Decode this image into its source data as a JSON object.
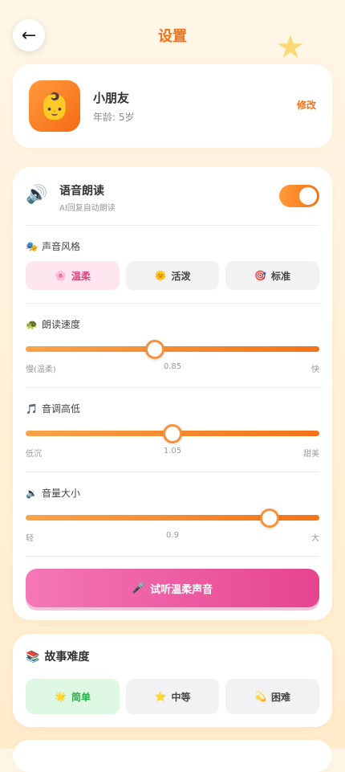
{
  "header": {
    "back_icon": "arrow-left-icon",
    "back_glyph": "←",
    "title": "设置",
    "decor_star": "★"
  },
  "profile": {
    "avatar_emoji": "👶",
    "name": "小朋友",
    "age_text": "年龄: 5岁",
    "edit_label": "修改"
  },
  "voice": {
    "speaker_glyph": "🔊",
    "title": "语音朗读",
    "subtitle": "AI回复自动朗读",
    "auto_read_enabled": true,
    "style": {
      "icon": "🎭",
      "label": "声音风格",
      "options": [
        {
          "icon": "🌸",
          "label": "温柔",
          "selected": true
        },
        {
          "icon": "🌞",
          "label": "活泼",
          "selected": false
        },
        {
          "icon": "🎯",
          "label": "标准",
          "selected": false
        }
      ]
    },
    "speed": {
      "icon": "🐢",
      "label": "朗读速度",
      "min_label": "慢(温柔)",
      "max_label": "快",
      "value_text": "0.85",
      "fraction": 0.44
    },
    "pitch": {
      "icon": "🎵",
      "label": "音调高低",
      "min_label": "低沉",
      "max_label": "甜美",
      "value_text": "1.05",
      "fraction": 0.5
    },
    "volume": {
      "icon": "🔉",
      "label": "音量大小",
      "min_label": "轻",
      "max_label": "大",
      "value_text": "0.9",
      "fraction": 0.83
    },
    "preview": {
      "icon": "🎤",
      "label": "试听温柔声音"
    }
  },
  "story": {
    "icon": "📚",
    "title": "故事难度",
    "options": [
      {
        "icon": "🌟",
        "label": "简单",
        "selected": true
      },
      {
        "icon": "⭐",
        "label": "中等",
        "selected": false
      },
      {
        "icon": "💫",
        "label": "困难",
        "selected": false
      }
    ]
  },
  "colors": {
    "accent": "#f47318",
    "pink": "#e64490",
    "green": "#2fae4f"
  }
}
